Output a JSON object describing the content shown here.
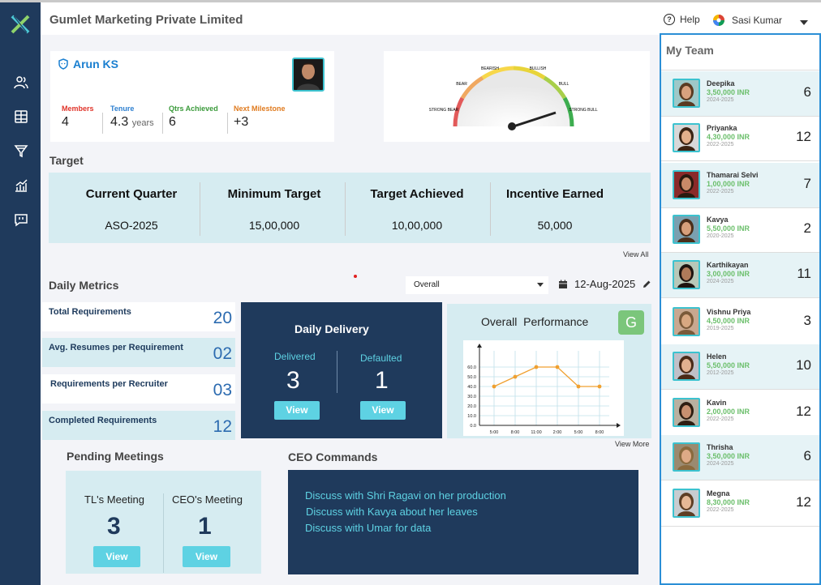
{
  "header": {
    "company": "Gumlet Marketing Private Limited",
    "help": "Help",
    "user": "Sasi Kumar"
  },
  "sidebar": {
    "icons": [
      "users-icon",
      "table-icon",
      "filter-icon",
      "chart-icon",
      "chat-icon"
    ]
  },
  "profile": {
    "name": "Arun KS",
    "stats": [
      {
        "label": "Members",
        "value": "4",
        "unit": "",
        "color": "#e0342a"
      },
      {
        "label": "Tenure",
        "value": "4.3",
        "unit": "years",
        "color": "#2c7fd0"
      },
      {
        "label": "Qtrs Achieved",
        "value": "6",
        "unit": "",
        "color": "#3a9a3a"
      },
      {
        "label": "Next Milestone",
        "value": "+3",
        "unit": "",
        "color": "#e07b1f"
      }
    ]
  },
  "gauge": {
    "labels": [
      "STRONG BEAR",
      "BEAR",
      "BEARISH",
      "BULLISH",
      "BULL",
      "STRONG BULL"
    ]
  },
  "target": {
    "title": "Target",
    "columns": [
      {
        "head": "Current Quarter",
        "value": "ASO-2025"
      },
      {
        "head": "Minimum Target",
        "value": "15,00,000"
      },
      {
        "head": "Target Achieved",
        "value": "10,00,000"
      },
      {
        "head": "Incentive Earned",
        "value": "50,000"
      }
    ],
    "view_all": "View All"
  },
  "daily": {
    "title": "Daily Metrics",
    "filter": "Overall",
    "date": "12-Aug-2025",
    "metrics": [
      {
        "label": "Total Requirements",
        "value": "20"
      },
      {
        "label": "Avg. Resumes per Requirement",
        "value": "02"
      },
      {
        "label": "Requirements per Recruiter",
        "value": "03"
      },
      {
        "label": "Completed Requirements",
        "value": "12"
      }
    ],
    "delivery": {
      "title": "Daily Delivery",
      "delivered_label": "Delivered",
      "delivered": "3",
      "defaulted_label": "Defaulted",
      "defaulted": "1",
      "view": "View"
    },
    "performance": {
      "title": "Overall  Performance",
      "grade": "G",
      "view_more": "View More"
    }
  },
  "chart_data": {
    "type": "line",
    "title": "",
    "categories": [
      "5:00",
      "8:00",
      "11:00",
      "2:00",
      "5:00",
      "8:00"
    ],
    "values": [
      40,
      50,
      60,
      60,
      40,
      40
    ],
    "yticks": [
      0,
      10,
      20,
      30,
      40,
      50,
      60
    ],
    "ylim": [
      0,
      70
    ],
    "color": "#f0a030",
    "grid": true
  },
  "meetings": {
    "title": "Pending Meetings",
    "tl_label": "TL's Meeting",
    "tl_value": "3",
    "ceo_label": "CEO's Meeting",
    "ceo_value": "1",
    "view": "View"
  },
  "ceo": {
    "title": "CEO Commands",
    "commands": [
      "Discuss with Shri Ragavi on her production",
      "Discuss with Kavya about her leaves",
      "Discuss with Umar for data"
    ]
  },
  "team": {
    "title": "My Team",
    "members": [
      {
        "name": "Deepika",
        "amount": "3,50,000 INR",
        "years": "2024-2025",
        "count": "6"
      },
      {
        "name": "Priyanka",
        "amount": "4,30,000 INR",
        "years": "2022-2025",
        "count": "12"
      },
      {
        "name": "Thamarai Selvi",
        "amount": "1,00,000 INR",
        "years": "2022-2025",
        "count": "7"
      },
      {
        "name": "Kavya",
        "amount": "5,50,000 INR",
        "years": "2020-2025",
        "count": "2"
      },
      {
        "name": "Karthikayan",
        "amount": "3,00,000 INR",
        "years": "2024-2025",
        "count": "11"
      },
      {
        "name": "Vishnu Priya",
        "amount": "4,50,000 INR",
        "years": "2019-2025",
        "count": "3"
      },
      {
        "name": "Helen",
        "amount": "5,50,000 INR",
        "years": "2012-2025",
        "count": "10"
      },
      {
        "name": "Kavin",
        "amount": "2,00,000 INR",
        "years": "2022-2025",
        "count": "12"
      },
      {
        "name": "Thrisha",
        "amount": "3,50,000 INR",
        "years": "2024-2025",
        "count": "6"
      },
      {
        "name": "Megna",
        "amount": "8,30,000 INR",
        "years": "2022-2025",
        "count": "12"
      }
    ]
  }
}
